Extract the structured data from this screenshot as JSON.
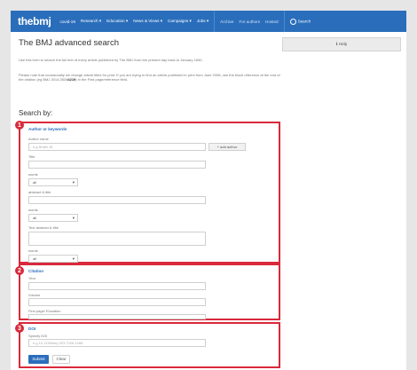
{
  "nav": {
    "logo": "thebmj",
    "items": [
      {
        "label": "covid-19",
        "light": false
      },
      {
        "label": "Research ▾",
        "light": false
      },
      {
        "label": "Education ▾",
        "light": false
      },
      {
        "label": "News & Views ▾",
        "light": false
      },
      {
        "label": "Campaigns ▾",
        "light": false
      },
      {
        "label": "Jobs ▾",
        "light": false
      },
      {
        "label": "Archive",
        "light": true
      },
      {
        "label": "For authors",
        "light": true
      },
      {
        "label": "Hosted",
        "light": true
      }
    ],
    "search_label": "Search"
  },
  "header": {
    "title": "The BMJ advanced search",
    "help_label": "ℹ Help"
  },
  "intro": {
    "line1": "Use this form to search the full text of every article published by The BMJ from the present day back to January 1840.",
    "line2_pre": "Please note that occasionally we change article titles for print. If you are trying to find an article published in print from June 2008, use the block reference at the end of the citation (eg BMJ 2014;353:",
    "line2_bold": "i4219",
    "line2_post": ") in the First page/reference field."
  },
  "search_by": "Search by:",
  "sections": {
    "author": {
      "number": "1",
      "title": "Author or keywords",
      "author_label": "Author name",
      "author_placeholder": "e.g Smith JE",
      "add_author": "+ add author",
      "title_label": "Title",
      "words1_label": "words",
      "words1_value": "all",
      "abstract_label": "abstract & title",
      "words2_label": "words",
      "words2_value": "all",
      "text_label": "Text abstract & title",
      "words3_label": "words",
      "words3_value": "all"
    },
    "citation": {
      "number": "2",
      "title": "Citation",
      "year_label": "Year",
      "volume_label": "Volume",
      "firstpage_label": "First page/ Elocation"
    },
    "doi": {
      "number": "3",
      "title": "DOI",
      "specify_label": "Specify DOI",
      "doi_placeholder": "e.g 10.1136/bmj.323.7326.1468",
      "submit_label": "Submit",
      "clear_label": "Clear"
    }
  },
  "colors": {
    "brand_blue": "#2a6ebb",
    "highlight_red": "#d9293b"
  }
}
